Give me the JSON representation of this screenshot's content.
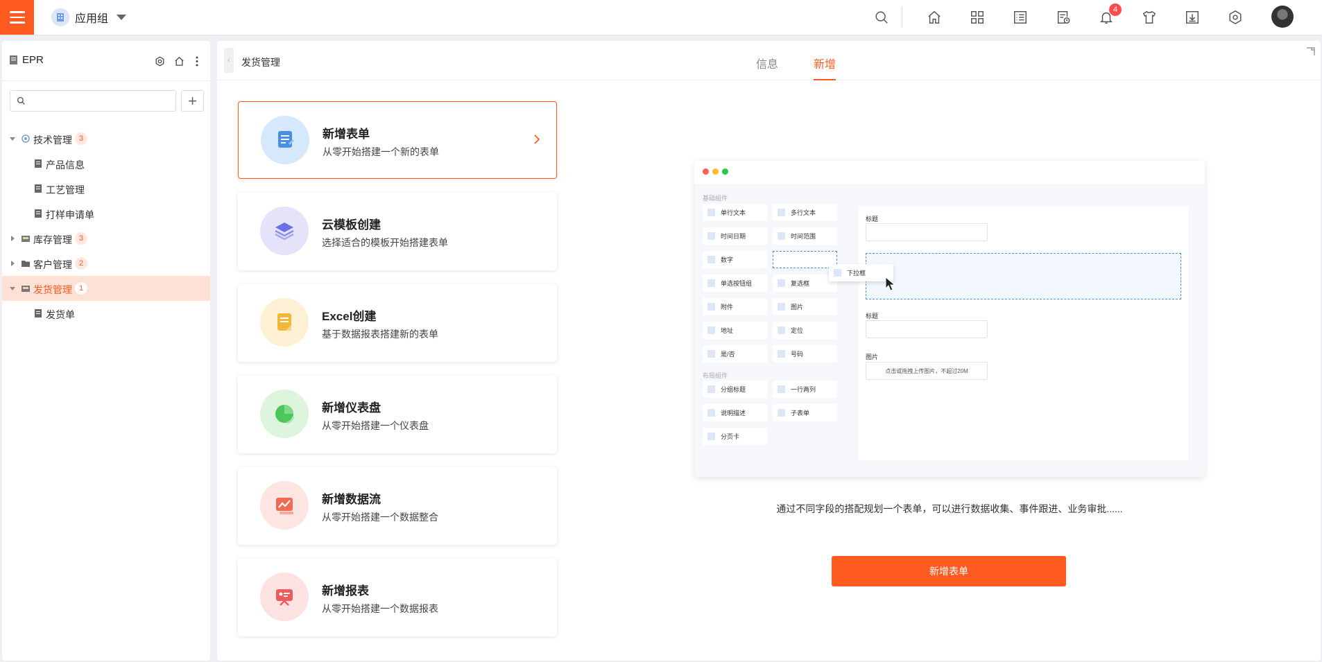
{
  "topbar": {
    "app_group_label": "应用组",
    "notification_count": "4"
  },
  "sidebar": {
    "title": "EPR",
    "search_placeholder": "",
    "add_label": "+",
    "tree": [
      {
        "label": "技术管理",
        "count": "3",
        "expanded": true,
        "icon": "gear-icon"
      },
      {
        "label": "产品信息",
        "child": true,
        "icon": "doc-icon"
      },
      {
        "label": "工艺管理",
        "child": true,
        "icon": "doc-icon"
      },
      {
        "label": "打样申请单",
        "child": true,
        "icon": "doc-icon"
      },
      {
        "label": "库存管理",
        "count": "3",
        "expanded": false,
        "icon": "folder-icon"
      },
      {
        "label": "客户管理",
        "count": "2",
        "expanded": false,
        "icon": "folder-icon"
      },
      {
        "label": "发货管理",
        "count": "1",
        "expanded": true,
        "selected": true,
        "icon": "folder-icon"
      },
      {
        "label": "发货单",
        "child": true,
        "icon": "doc-icon"
      }
    ]
  },
  "main": {
    "breadcrumb": "发货管理",
    "tabs": [
      {
        "label": "信息",
        "active": false
      },
      {
        "label": "新增",
        "active": true
      }
    ],
    "cards": [
      {
        "title": "新增表单",
        "desc": "从零开始搭建一个新的表单",
        "icon": "form-icon",
        "color": "#d6e8fb",
        "accent": "#4a90e2",
        "active": true
      },
      {
        "title": "云模板创建",
        "desc": "选择适合的模板开始搭建表单",
        "icon": "layers-icon",
        "color": "#e4e3fa",
        "accent": "#6c6ee6"
      },
      {
        "title": "Excel创建",
        "desc": "基于数据报表搭建新的表单",
        "icon": "excel-icon",
        "color": "#fdf0d5",
        "accent": "#f3b73a"
      },
      {
        "title": "新增仪表盘",
        "desc": "从零开始搭建一个仪表盘",
        "icon": "dashboard-icon",
        "color": "#dcf5dc",
        "accent": "#4cc75b"
      },
      {
        "title": "新增数据流",
        "desc": "从零开始搭建一个数据整合",
        "icon": "dataflow-icon",
        "color": "#fde6e2",
        "accent": "#f06a55"
      },
      {
        "title": "新增报表",
        "desc": "从零开始搭建一个数据报表",
        "icon": "report-icon",
        "color": "#fde2e2",
        "accent": "#ef5a5a"
      }
    ],
    "preview": {
      "basic_section": "基础组件",
      "layout_section": "布局组件",
      "basic_components": [
        "单行文本",
        "多行文本",
        "时间日期",
        "时间范围",
        "数字",
        "",
        "单选按钮组",
        "复选框",
        "附件",
        "图片",
        "地址",
        "定位",
        "是/否",
        "号码"
      ],
      "layout_components": [
        "分组标题",
        "一行两列",
        "说明描述",
        "子表单",
        "分页卡"
      ],
      "drag_label": "下拉框",
      "field_title_1": "标题",
      "field_title_2": "标题",
      "field_image": "图片",
      "upload_hint": "点击或拖拽上传图片，不超过20M"
    },
    "description": "通过不同字段的搭配规划一个表单，可以进行数据收集、事件跟进、业务审批......",
    "primary_button": "新增表单"
  }
}
